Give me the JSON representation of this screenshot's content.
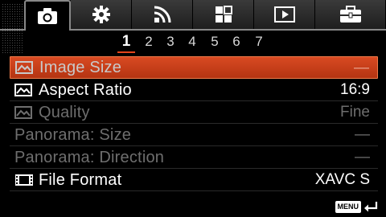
{
  "tabs": [
    {
      "name": "camera",
      "icon": "camera-icon",
      "active": true
    },
    {
      "name": "settings",
      "icon": "gear-icon",
      "active": false
    },
    {
      "name": "network",
      "icon": "wireless-icon",
      "active": false
    },
    {
      "name": "application",
      "icon": "grid-icon",
      "active": false
    },
    {
      "name": "playback",
      "icon": "play-icon",
      "active": false
    },
    {
      "name": "setup",
      "icon": "toolbox-icon",
      "active": false
    }
  ],
  "pages": {
    "items": [
      "1",
      "2",
      "3",
      "4",
      "5",
      "6",
      "7"
    ],
    "current": "1"
  },
  "menu": {
    "items": [
      {
        "label": "Image Size",
        "value": "—",
        "icon": "still-image-icon",
        "state": "selected-dimmed"
      },
      {
        "label": "Aspect Ratio",
        "value": "16:9",
        "icon": "still-image-icon",
        "state": "enabled"
      },
      {
        "label": "Quality",
        "value": "Fine",
        "icon": "still-image-icon",
        "state": "disabled"
      },
      {
        "label": "Panorama: Size",
        "value": "—",
        "icon": "",
        "state": "disabled"
      },
      {
        "label": "Panorama: Direction",
        "value": "—",
        "icon": "",
        "state": "disabled"
      },
      {
        "label": "File Format",
        "value": "XAVC S",
        "icon": "film-icon",
        "state": "enabled"
      }
    ]
  },
  "footer": {
    "menu_key_label": "MENU",
    "back_icon": "return-arrow-icon"
  },
  "colors": {
    "highlight": "#c8401a",
    "page_underline": "#e2451b",
    "disabled_text": "#6e6e6e"
  }
}
